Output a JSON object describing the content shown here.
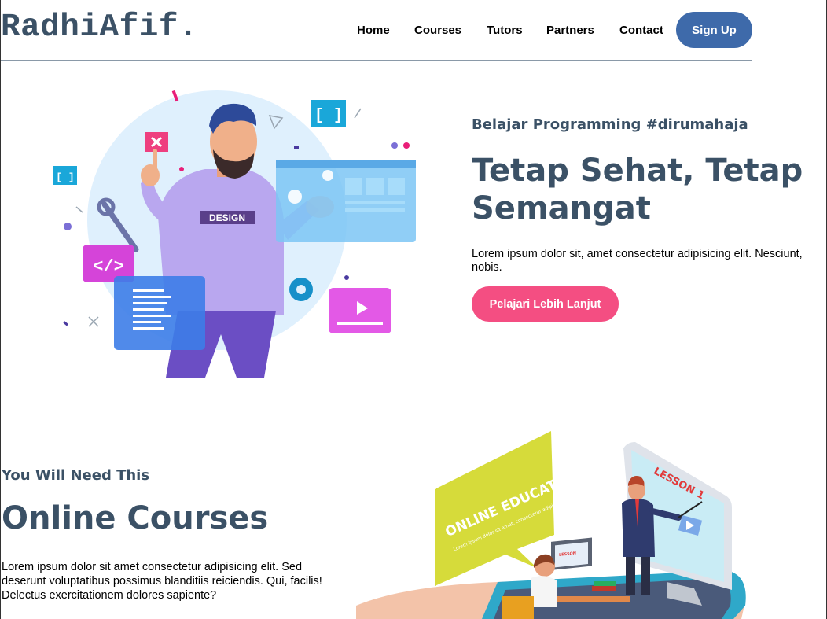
{
  "header": {
    "logo": "RadhiAfif.",
    "nav": [
      "Home",
      "Courses",
      "Tutors",
      "Partners",
      "Contact"
    ],
    "signup_label": "Sign Up",
    "accent_color": "#3e6aaa"
  },
  "hero": {
    "subtitle": "Belajar Programming #dirumahaja",
    "title": "Tetap Sehat, Tetap Semangat",
    "text": "Lorem ipsum dolor sit, amet consectetur adipisicing elit. Nesciunt, nobis.",
    "cta_label": "Pelajari Lebih Lanjut",
    "cta_color": "#f44e82",
    "illustration": {
      "shirt_label": "DESIGN",
      "icon": "developer-illustration"
    }
  },
  "courses": {
    "subtitle": "You Will Need This",
    "title": "Online Courses",
    "text": "Lorem ipsum dolor sit amet consectetur adipisicing elit. Sed deserunt voluptatibus possimus blanditiis reiciendis. Qui, facilis! Delectus exercitationem dolores sapiente?",
    "illustration": {
      "bubble_title": "ONLINE EDUCATION",
      "bubble_text": "Lorem ipsum dolor sit amet, consectetur adipiscing elit, sed do eiusmod tempor incididunt ut labore et dolore magna.",
      "screen_text": "LESSON 1",
      "laptop_text": "LESSON",
      "icon": "online-education-illustration"
    }
  }
}
